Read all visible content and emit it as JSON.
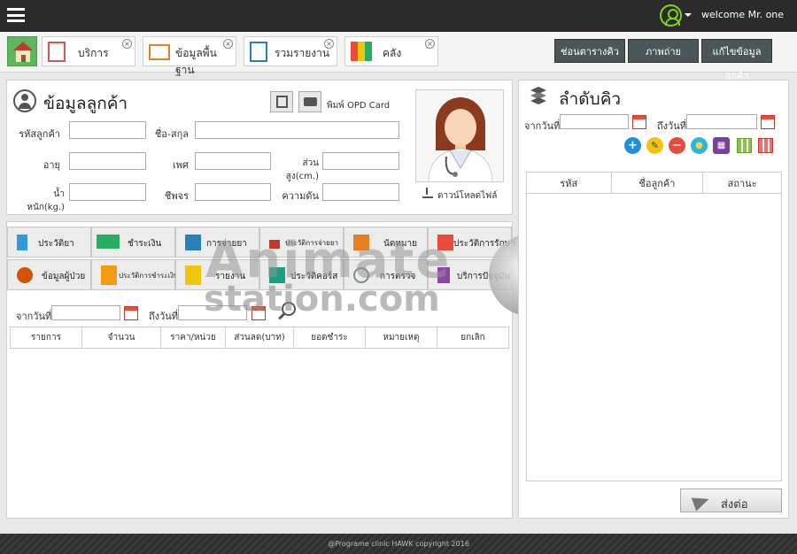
{
  "header": {
    "welcome": "welcome Mr. one"
  },
  "tabs": [
    {
      "label": "บริการ"
    },
    {
      "label": "ข้อมูลพื้นฐาน"
    },
    {
      "label": "รวมรายงาน"
    },
    {
      "label": "คลัง"
    }
  ],
  "header_buttons": {
    "queue_schedule": "ช่อนตารางคิว",
    "photo": "ภาพถ่าย",
    "edit_customer": "แก้ไขข้อมูลลูกค้า"
  },
  "customer": {
    "title": "ข้อมูลลูกค้า",
    "print_label": "พิมพ์ OPD Card",
    "download_label": "ดาวน์โหลดไฟล์",
    "fields": {
      "code": "รหัสลูกค้า",
      "fullname": "ชื่อ-สกุล",
      "age": "อายุ",
      "sex": "เพศ",
      "height": "ส่วนสูง(cm.)",
      "weight": "น้ำหนัก(kg.)",
      "pulse": "ชีพจร",
      "pressure": "ความดัน"
    }
  },
  "functions": [
    {
      "label": "ประวัติยา",
      "color": "#3498db"
    },
    {
      "label": "ชำระเงิน",
      "color": "#27ae60"
    },
    {
      "label": "การจ่ายยา",
      "color": "#2980b9"
    },
    {
      "label": "ประวัติการจ่ายยา",
      "color": "#c0392b"
    },
    {
      "label": "นัดหมาย",
      "color": "#e67e22"
    },
    {
      "label": "ประวัติการรักษา",
      "color": "#e74c3c"
    },
    {
      "label": "ข้อมูลผู้ป่วย",
      "color": "#d35400"
    },
    {
      "label": "ประวัติการชำระเงิน",
      "color": "#f39c12"
    },
    {
      "label": "รายงาน",
      "color": "#f1c40f"
    },
    {
      "label": "ประวัติคอร์ส",
      "color": "#16a085"
    },
    {
      "label": "การตรวจ",
      "color": "#7f8c8d"
    },
    {
      "label": "บริการปัจจุบัน",
      "color": "#8e44ad"
    }
  ],
  "history_filter": {
    "from_label": "จากวันที่",
    "to_label": "ถึงวันที่"
  },
  "history_table": {
    "columns": [
      "รายการ",
      "จำนวน",
      "ราคา/หน่วย",
      "ส่วนลด(บาท)",
      "ยอดชำระ",
      "หมายเหตุ",
      "ยกเลิก"
    ]
  },
  "queue": {
    "title": "ลำดับคิว",
    "from_label": "จากวันที่",
    "to_label": "ถึงวันที่",
    "columns": [
      "รหัส",
      "ชื่อลูกค้า",
      "สถานะ"
    ],
    "send_label": "ส่งต่อ"
  },
  "footer": "@Programe clinic HAWK copyright 2016",
  "watermark": {
    "line1": "Animate",
    "line2": "station.com"
  }
}
